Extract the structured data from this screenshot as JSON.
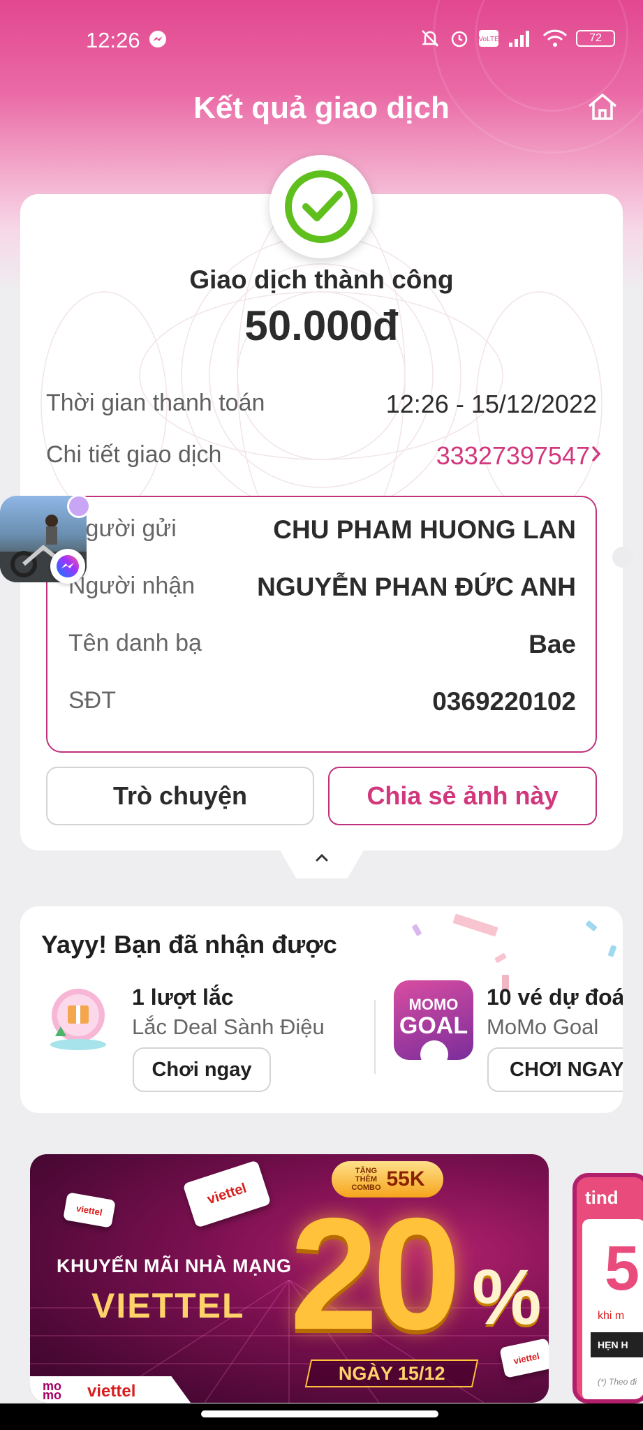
{
  "status_bar": {
    "time": "12:26",
    "battery": "72"
  },
  "header": {
    "title": "Kết quả giao dịch"
  },
  "result": {
    "status": "Giao dịch thành công",
    "amount": "50.000đ",
    "payment_time_label": "Thời gian thanh toán",
    "payment_time_value": "12:26 - 15/12/2022",
    "detail_label": "Chi tiết giao dịch",
    "detail_value": "33327397547"
  },
  "info": {
    "sender_label": "Người gửi",
    "sender_value": "CHU PHAM HUONG LAN",
    "receiver_label": "Người nhận",
    "receiver_value": "NGUYỄN PHAN ĐỨC ANH",
    "contact_label": "Tên danh bạ",
    "contact_value": "Bae",
    "phone_label": "SĐT",
    "phone_value": "0369220102"
  },
  "buttons": {
    "chat": "Trò chuyện",
    "share": "Chia sẻ ảnh này"
  },
  "rewards": {
    "title": "Yayy! Bạn đã nhận được",
    "items": [
      {
        "name": "1 lượt lắc",
        "sub": "Lắc Deal Sành Điệu",
        "cta": "Chơi ngay"
      },
      {
        "name": "10 vé dự đoá",
        "sub": "MoMo Goal",
        "cta": "CHƠI NGAY",
        "logo_line1": "MOMO",
        "logo_line2": "GOAL"
      }
    ]
  },
  "banner": {
    "combo_small": "TẶNG THÊM COMBO",
    "combo_big": "55K",
    "line1": "KHUYẾN MÃI NHÀ MẠNG",
    "line2": "VIETTEL",
    "big_number": "20",
    "percent": "%",
    "date": "NGÀY 15/12",
    "card_brand": "viettel",
    "footer_momo": "mo mo",
    "footer_brand": "viettel"
  },
  "side_banner": {
    "logo": "tind",
    "big": "5",
    "small": "khi m",
    "button": "HẸN H",
    "foot": "(*) Theo đi"
  },
  "colors": {
    "brand_pink": "#d2377d",
    "border_pink": "#c0307b",
    "success_green": "#5fbf1d"
  }
}
